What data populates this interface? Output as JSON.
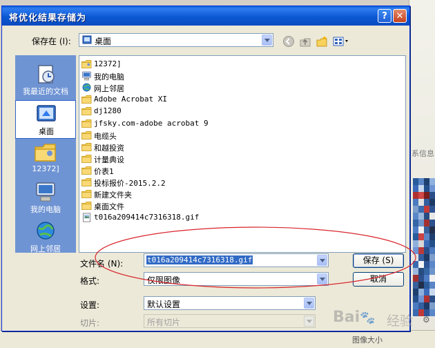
{
  "dialog": {
    "title": "将优化结果存储为",
    "help_glyph": "?",
    "close_glyph": "✕"
  },
  "save_in": {
    "label": "保存在 (I):",
    "value": "桌面"
  },
  "places": [
    {
      "label": "我最近的文档",
      "icon": "recent-documents-icon"
    },
    {
      "label": "桌面",
      "icon": "desktop-icon",
      "selected": true
    },
    {
      "label": "12372]",
      "icon": "user-folder-icon"
    },
    {
      "label": "我的电脑",
      "icon": "my-computer-icon"
    },
    {
      "label": "网上邻居",
      "icon": "network-places-icon"
    }
  ],
  "files": [
    {
      "name": "12372]",
      "icon": "user-folder-icon"
    },
    {
      "name": "我的电脑",
      "icon": "my-computer-icon"
    },
    {
      "name": "网上邻居",
      "icon": "network-places-icon"
    },
    {
      "name": "Adobe Acrobat XI",
      "icon": "folder-icon"
    },
    {
      "name": "dj1280",
      "icon": "folder-icon"
    },
    {
      "name": "jfsky.com-adobe acrobat 9",
      "icon": "folder-icon"
    },
    {
      "name": "电缆头",
      "icon": "folder-icon"
    },
    {
      "name": "和越投资",
      "icon": "folder-icon"
    },
    {
      "name": "计量典设",
      "icon": "folder-icon"
    },
    {
      "name": "价表1",
      "icon": "folder-icon"
    },
    {
      "name": "投标报价-2015.2.2",
      "icon": "folder-icon"
    },
    {
      "name": "新建文件夹",
      "icon": "folder-icon"
    },
    {
      "name": "桌面文件",
      "icon": "folder-icon"
    },
    {
      "name": "t016a209414c7316318.gif",
      "icon": "gif-file-icon"
    }
  ],
  "filename": {
    "label": "文件名 (N):",
    "value": "t016a209414c7316318.gif"
  },
  "format": {
    "label": "格式:",
    "value": "仅限图像"
  },
  "settings": {
    "label": "设置:",
    "value": "默认设置"
  },
  "slices": {
    "label": "切片:",
    "value": "所有切片"
  },
  "buttons": {
    "save": "保存 (S)",
    "cancel": "取消"
  },
  "background": {
    "hint": "系信息",
    "bottom_text": "图像大小"
  },
  "watermark": {
    "brand": "Bai",
    "brand2": "经验"
  },
  "colors": {
    "accent": "#0a5fd8",
    "places_bg": "#6f94d4",
    "annotation": "#d8232a"
  }
}
